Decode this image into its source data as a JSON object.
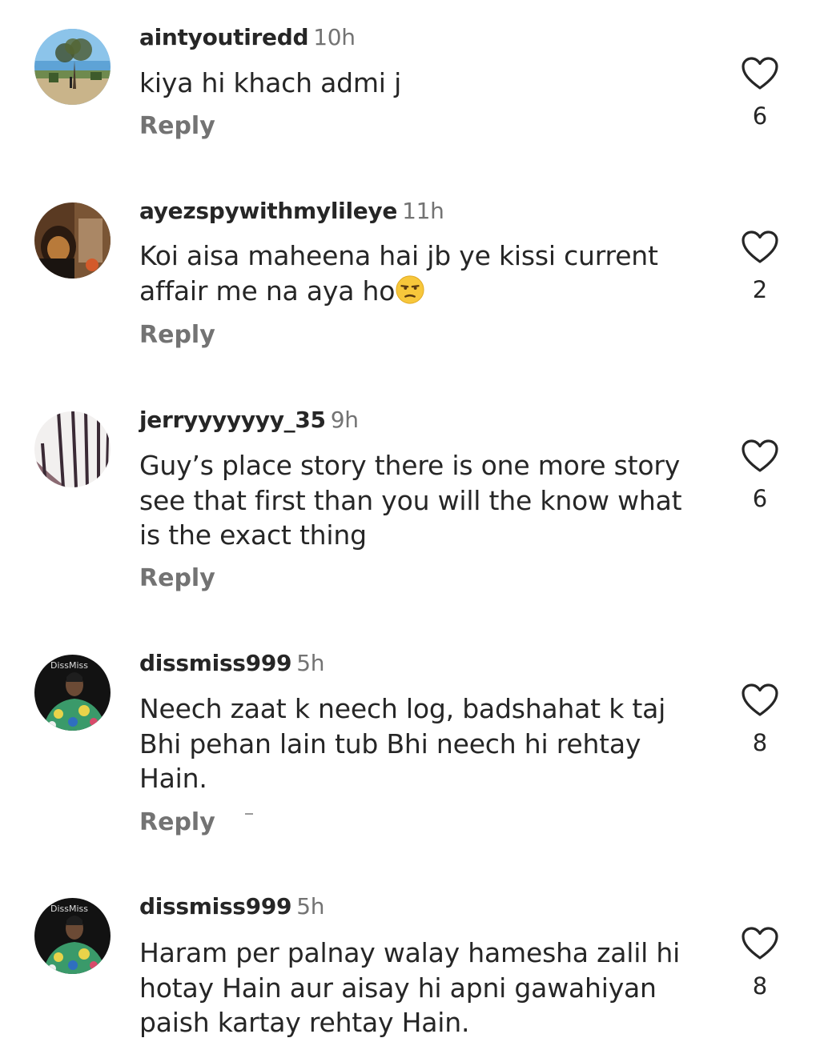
{
  "comments": [
    {
      "username": "aintyoutiredd",
      "time": "10h",
      "text": "kiya hi khach admi j",
      "reply": "Reply",
      "likes": "6",
      "avatar": "landscape-tree-avatar"
    },
    {
      "username": "ayezspywithmylileye",
      "time": "11h",
      "text": "Koi aisa maheena hai jb ye kissi current affair me na aya ho",
      "emoji": "unamused-face-emoji",
      "reply": "Reply",
      "likes": "2",
      "avatar": "dim-portrait-avatar"
    },
    {
      "username": "jerryyyyyyy_35",
      "time": "9h",
      "text": "Guy’s place story there is one more story see that first than you will the know what is the exact thing",
      "reply": "Reply",
      "likes": "6",
      "avatar": "striped-fabric-avatar"
    },
    {
      "username": "dissmiss999",
      "time": "5h",
      "text": "Neech zaat k neech log, badshahat k taj Bhi pehan lain tub Bhi neech hi rehtay Hain.",
      "reply": "Reply",
      "likes": "8",
      "avatar": "dissmiss-logo-avatar",
      "avatar_text": "DissMiss"
    },
    {
      "username": "dissmiss999",
      "time": "5h",
      "text": "Haram per palnay walay hamesha zalil hi hotay Hain aur aisay hi apni gawahiyan paish kartay rehtay Hain.",
      "reply": "",
      "likes": "8",
      "avatar": "dissmiss-logo-avatar",
      "avatar_text": "DissMiss"
    }
  ],
  "colors": {
    "primary_text": "#262626",
    "secondary_text": "#737373",
    "background": "#ffffff"
  }
}
